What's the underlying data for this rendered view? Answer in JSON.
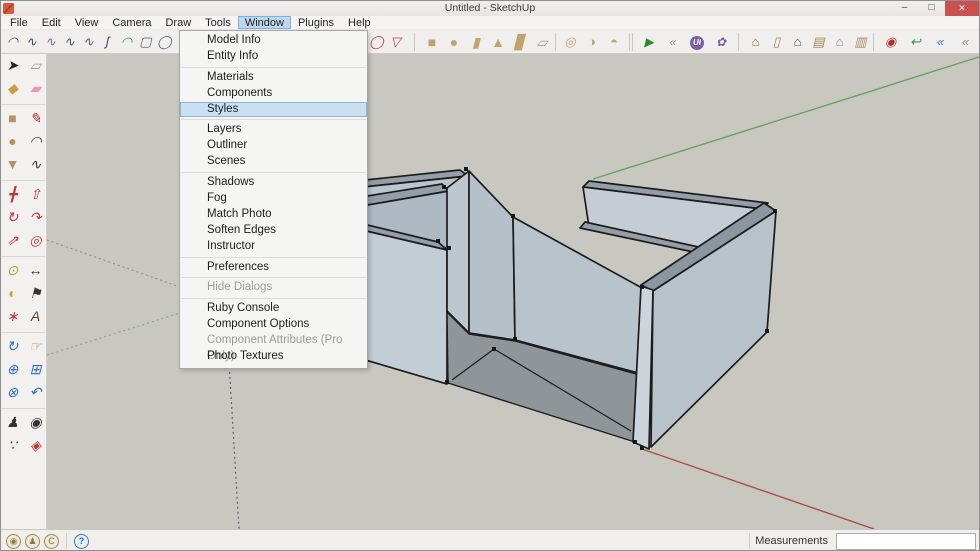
{
  "window": {
    "title": "Untitled - SketchUp",
    "controls": {
      "minimize": "–",
      "restore": "□",
      "close": "✕"
    }
  },
  "menubar": {
    "items": [
      {
        "name": "menu-file",
        "label": "File"
      },
      {
        "name": "menu-edit",
        "label": "Edit"
      },
      {
        "name": "menu-view",
        "label": "View"
      },
      {
        "name": "menu-camera",
        "label": "Camera"
      },
      {
        "name": "menu-draw",
        "label": "Draw"
      },
      {
        "name": "menu-tools",
        "label": "Tools"
      },
      {
        "name": "menu-window",
        "label": "Window",
        "active": true
      },
      {
        "name": "menu-plugins",
        "label": "Plugins"
      },
      {
        "name": "menu-help",
        "label": "Help"
      }
    ]
  },
  "window_menu": {
    "items": [
      {
        "label": "Model Info",
        "state": "normal"
      },
      {
        "label": "Entity Info",
        "state": "normal"
      },
      {
        "label": "Materials",
        "state": "normal"
      },
      {
        "label": "Components",
        "state": "normal"
      },
      {
        "label": "Styles",
        "state": "highlighted"
      },
      {
        "label": "Layers",
        "state": "normal"
      },
      {
        "label": "Outliner",
        "state": "normal"
      },
      {
        "label": "Scenes",
        "state": "normal"
      },
      {
        "label": "Shadows",
        "state": "normal"
      },
      {
        "label": "Fog",
        "state": "normal"
      },
      {
        "label": "Match Photo",
        "state": "normal"
      },
      {
        "label": "Soften Edges",
        "state": "normal"
      },
      {
        "label": "Instructor",
        "state": "normal"
      },
      {
        "label": "Preferences",
        "state": "normal"
      },
      {
        "label": "Hide Dialogs",
        "state": "disabled"
      },
      {
        "label": "Ruby Console",
        "state": "normal"
      },
      {
        "label": "Component Options",
        "state": "normal"
      },
      {
        "label": "Component Attributes (Pro Only)",
        "state": "disabled"
      },
      {
        "label": "Photo Textures",
        "state": "normal"
      }
    ]
  },
  "top_toolbar": {
    "groups": {
      "sandbox": [
        {
          "name": "arc-tool-icon",
          "glyph": "◠",
          "color": "#44506b"
        },
        {
          "name": "bezier-curve-icon",
          "glyph": "∿",
          "color": "#44506b"
        },
        {
          "name": "bezier-edit-icon",
          "glyph": "∿",
          "color": "#6b7387"
        },
        {
          "name": "polyline-curve-icon",
          "glyph": "∿",
          "color": "#44506b"
        },
        {
          "name": "spline-icon",
          "glyph": "∿",
          "color": "#55607a"
        },
        {
          "name": "s-curve-icon",
          "glyph": "ʃ",
          "color": "#44506b"
        },
        {
          "name": "green-arc-icon",
          "glyph": "◠",
          "color": "#3f8f4f"
        },
        {
          "name": "rounded-rect-icon",
          "glyph": "▢",
          "color": "#5a6478"
        },
        {
          "name": "circle-shape-icon",
          "glyph": "◯",
          "color": "#5a6478"
        }
      ],
      "shapes2d": [
        {
          "name": "oval-shape-icon",
          "glyph": "◯",
          "color": "#c04040"
        },
        {
          "name": "wedge-shape-icon",
          "glyph": "▽",
          "color": "#c04040"
        }
      ],
      "solids": [
        {
          "name": "box-solid-icon",
          "glyph": "■",
          "color": "#c2a26e"
        },
        {
          "name": "sphere-solid-icon",
          "glyph": "●",
          "color": "#c2a26e"
        },
        {
          "name": "cylinder-solid-icon",
          "glyph": "▮",
          "color": "#c2a26e"
        },
        {
          "name": "cone-solid-icon",
          "glyph": "▲",
          "color": "#c2a26e"
        },
        {
          "name": "dome-solid-icon",
          "glyph": "▊",
          "color": "#c2a26e"
        },
        {
          "name": "plane-solid-icon",
          "glyph": "▱",
          "color": "#9aa0a8"
        }
      ],
      "extras": [
        {
          "name": "torus-solid-icon",
          "glyph": "◎",
          "color": "#c2a26e"
        },
        {
          "name": "sphere-tool-icon",
          "glyph": "◑",
          "color": "#c2a26e"
        },
        {
          "name": "dome-arrow-icon",
          "glyph": "◓",
          "color": "#c2a26e"
        }
      ],
      "plugins": [
        {
          "name": "play-plugin-icon",
          "glyph": "▶",
          "color": "#2c8c2c"
        },
        {
          "name": "rewind-plugin-icon",
          "glyph": "«",
          "color": "#8a8a8a"
        },
        {
          "name": "ui-plugin-icon",
          "glyph": "UI",
          "color": "#ffffff"
        },
        {
          "name": "flower-plugin-icon",
          "glyph": "✿",
          "color": "#7a5ea8"
        }
      ],
      "house": [
        {
          "name": "house-textured-icon",
          "glyph": "⌂",
          "color": "#8a6d4a"
        },
        {
          "name": "door-panel-icon",
          "glyph": "▯",
          "color": "#a8875f"
        },
        {
          "name": "house-solid-icon",
          "glyph": "⌂",
          "color": "#4a4a4a"
        },
        {
          "name": "window-panel-icon",
          "glyph": "▤",
          "color": "#a8875f"
        },
        {
          "name": "house-outline-icon",
          "glyph": "⌂",
          "color": "#8a8a8a"
        },
        {
          "name": "garage-icon",
          "glyph": "▥",
          "color": "#a8875f"
        }
      ],
      "capture": [
        {
          "name": "record-icon",
          "glyph": "◉",
          "color": "#b03030"
        },
        {
          "name": "undo-arrow-icon",
          "glyph": "↩",
          "color": "#3a8c5c"
        },
        {
          "name": "back-blue-icon",
          "glyph": "«",
          "color": "#2f7fd0"
        },
        {
          "name": "back-gray-icon",
          "glyph": "«",
          "color": "#8a8a8a"
        }
      ]
    }
  },
  "left_toolbar": {
    "items": [
      {
        "name": "select-tool",
        "glyph": "➤",
        "color": "#222222"
      },
      {
        "name": "make-component-tool",
        "glyph": "▱",
        "color": "#9a9a9a"
      },
      {
        "name": "paint-bucket-tool",
        "glyph": "◆",
        "color": "#c9a23c"
      },
      {
        "name": "eraser-tool",
        "glyph": "▰",
        "color": "#e89cb0"
      },
      {
        "name": "toolbar-divider",
        "divider": true
      },
      {
        "name": "rectangle-tool",
        "glyph": "■",
        "color": "#b3935f"
      },
      {
        "name": "line-tool",
        "glyph": "✎",
        "color": "#b03030"
      },
      {
        "name": "circle-tool",
        "glyph": "●",
        "color": "#b3935f"
      },
      {
        "name": "arc-tool",
        "glyph": "◠",
        "color": "#333333"
      },
      {
        "name": "polygon-tool",
        "glyph": "▼",
        "color": "#b3935f"
      },
      {
        "name": "freehand-tool",
        "glyph": "∿",
        "color": "#333333"
      },
      {
        "name": "toolbar-divider",
        "divider": true
      },
      {
        "name": "move-tool",
        "glyph": "╋",
        "color": "#c03434"
      },
      {
        "name": "push-pull-tool",
        "glyph": "⇧",
        "color": "#c03434"
      },
      {
        "name": "rotate-tool",
        "glyph": "↻",
        "color": "#c03434"
      },
      {
        "name": "follow-me-tool",
        "glyph": "↷",
        "color": "#c03434"
      },
      {
        "name": "scale-tool",
        "glyph": "⇗",
        "color": "#c03434"
      },
      {
        "name": "offset-tool",
        "glyph": "◎",
        "color": "#c03434"
      },
      {
        "name": "toolbar-divider",
        "divider": true
      },
      {
        "name": "tape-measure-tool",
        "glyph": "⊙",
        "color": "#b3a030"
      },
      {
        "name": "dimension-tool",
        "glyph": "↔",
        "color": "#333333"
      },
      {
        "name": "protractor-tool",
        "glyph": "◐",
        "color": "#c2a53c"
      },
      {
        "name": "text-tool",
        "glyph": "⚑",
        "color": "#333333"
      },
      {
        "name": "axes-tool",
        "glyph": "∗",
        "color": "#c03434"
      },
      {
        "name": "3d-text-tool",
        "glyph": "A",
        "color": "#5a4632"
      },
      {
        "name": "toolbar-divider",
        "divider": true
      },
      {
        "name": "orbit-tool",
        "glyph": "↻",
        "color": "#2f6fc0"
      },
      {
        "name": "pan-tool",
        "glyph": "☞",
        "color": "#b08a5a"
      },
      {
        "name": "zoom-tool",
        "glyph": "⊕",
        "color": "#2f6fc0"
      },
      {
        "name": "zoom-window-tool",
        "glyph": "⊞",
        "color": "#2f6fc0"
      },
      {
        "name": "zoom-extents-tool",
        "glyph": "⊗",
        "color": "#2f6fc0"
      },
      {
        "name": "zoom-previous-tool",
        "glyph": "↶",
        "color": "#2f6fc0"
      },
      {
        "name": "toolbar-divider",
        "divider": true
      },
      {
        "name": "position-camera-tool",
        "glyph": "♟",
        "color": "#333333"
      },
      {
        "name": "look-around-tool",
        "glyph": "◉",
        "color": "#333333"
      },
      {
        "name": "walk-tool",
        "glyph": "∵",
        "color": "#333333"
      },
      {
        "name": "section-plane-tool",
        "glyph": "◈",
        "color": "#c03434"
      }
    ]
  },
  "viewport": {
    "background": "#c8c8c1",
    "axis_red": "#a65048",
    "axis_green": "#6aa066",
    "axis_blue": "#60606a",
    "model_face_light": "#c3cdd5",
    "model_face_mid": "#b7c2cb",
    "model_top_strip": "#939ea9",
    "model_floor": "#8f9599",
    "edge_color": "#1c1c1c"
  },
  "statusbar": {
    "icons": [
      {
        "name": "geolocation-icon",
        "glyph": "◉"
      },
      {
        "name": "credit-icon",
        "glyph": "♟"
      },
      {
        "name": "claim-credit-icon",
        "glyph": "C"
      }
    ],
    "help_icon": "?",
    "measurements_label": "Measurements",
    "measurements_value": ""
  }
}
